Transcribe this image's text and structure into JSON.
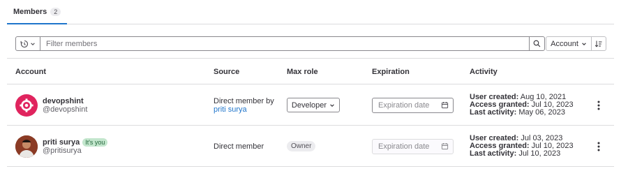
{
  "tabs": [
    {
      "label": "Members",
      "count": "2"
    }
  ],
  "filter": {
    "placeholder": "Filter members",
    "sort_label": "Account"
  },
  "columns": {
    "account": "Account",
    "source": "Source",
    "max_role": "Max role",
    "expiration": "Expiration",
    "activity": "Activity"
  },
  "members": [
    {
      "name": "devopshint",
      "username": "@devopshint",
      "source_line": "Direct member by",
      "source_link": "priti surya",
      "role": "Developer",
      "expiration_placeholder": "Expiration date",
      "activity": {
        "created_label": "User created:",
        "created": "Aug 10, 2021",
        "granted_label": "Access granted:",
        "granted": "Jul 10, 2023",
        "last_label": "Last activity:",
        "last": "May 06, 2023"
      }
    },
    {
      "name": "priti surya",
      "badge": "It's you",
      "username": "@pritisurya",
      "source_line": "Direct member",
      "role": "Owner",
      "expiration_placeholder": "Expiration date",
      "activity": {
        "created_label": "User created:",
        "created": "Jul 03, 2023",
        "granted_label": "Access granted:",
        "granted": "Jul 10, 2023",
        "last_label": "Last activity:",
        "last": "Jul 10, 2023"
      }
    }
  ],
  "colors": {
    "accent": "#1f75cb",
    "brand_avatar": "#e0245e",
    "badge_success_bg": "#c3e6cd"
  }
}
